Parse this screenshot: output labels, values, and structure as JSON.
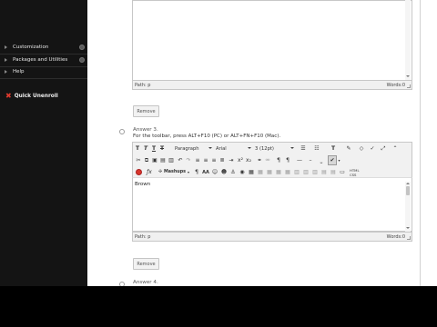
{
  "sidebar": {
    "items": [
      {
        "label": "Customization"
      },
      {
        "label": "Packages and Utilities"
      },
      {
        "label": "Help"
      }
    ],
    "quick_unenroll": "Quick Unenroll"
  },
  "prev_editor": {
    "path_label": "Path: p",
    "words_label": "Words:0",
    "remove_label": "Remove"
  },
  "answer3": {
    "label": "Answer 3.",
    "help": "For the toolbar, press ALT+F10 (PC) or ALT+FN+F10 (Mac).",
    "toolbar": {
      "paragraph": "Paragraph",
      "font": "Arial",
      "size": "3 (12pt)",
      "mashups": "Mashups",
      "html_css": "HTML CSS"
    },
    "content": "Brown",
    "path_label": "Path: p",
    "words_label": "Words:0",
    "remove_label": "Remove"
  },
  "answer4": {
    "label": "Answer 4."
  }
}
